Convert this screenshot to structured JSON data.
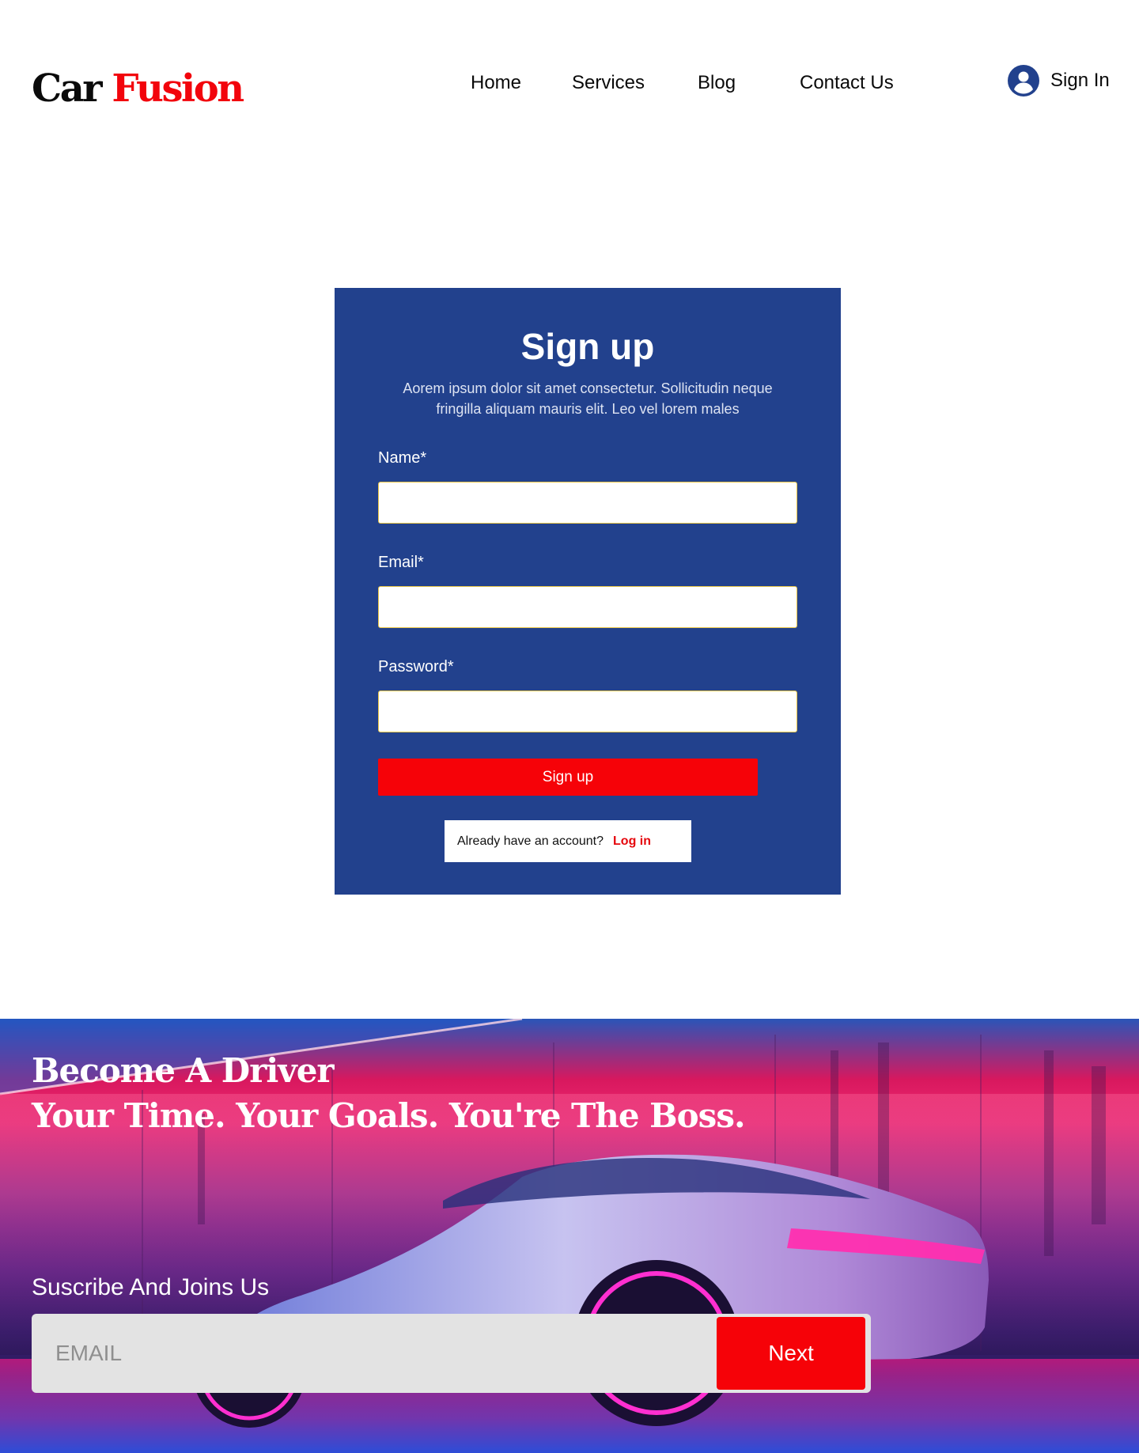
{
  "header": {
    "logo": {
      "word1": "Car",
      "word2": "Fusion"
    },
    "nav": [
      {
        "label": "Home"
      },
      {
        "label": "Services"
      },
      {
        "label": "Blog"
      },
      {
        "label": "Contact Us"
      }
    ],
    "signin_label": "Sign In",
    "avatar_icon": "user-circle-icon"
  },
  "signup": {
    "title": "Sign up",
    "subtitle": "Aorem ipsum dolor sit amet consectetur. Sollicitudin neque fringilla aliquam mauris elit. Leo vel lorem males",
    "fields": [
      {
        "label": "Name*",
        "value": ""
      },
      {
        "label": "Email*",
        "value": ""
      },
      {
        "label": "Password*",
        "value": ""
      }
    ],
    "submit_label": "Sign up",
    "login_prompt": "Already have an account?",
    "login_link": "Log in"
  },
  "hero": {
    "line1": "Become A Driver",
    "line2": "Your Time. Your Goals. You're The Boss.",
    "subscribe_title": "Suscribe And Joins Us",
    "email_placeholder": "EMAIL",
    "next_label": "Next"
  },
  "colors": {
    "brand_red": "#f60208",
    "card_blue": "#22418d",
    "input_border": "#e8c547"
  }
}
